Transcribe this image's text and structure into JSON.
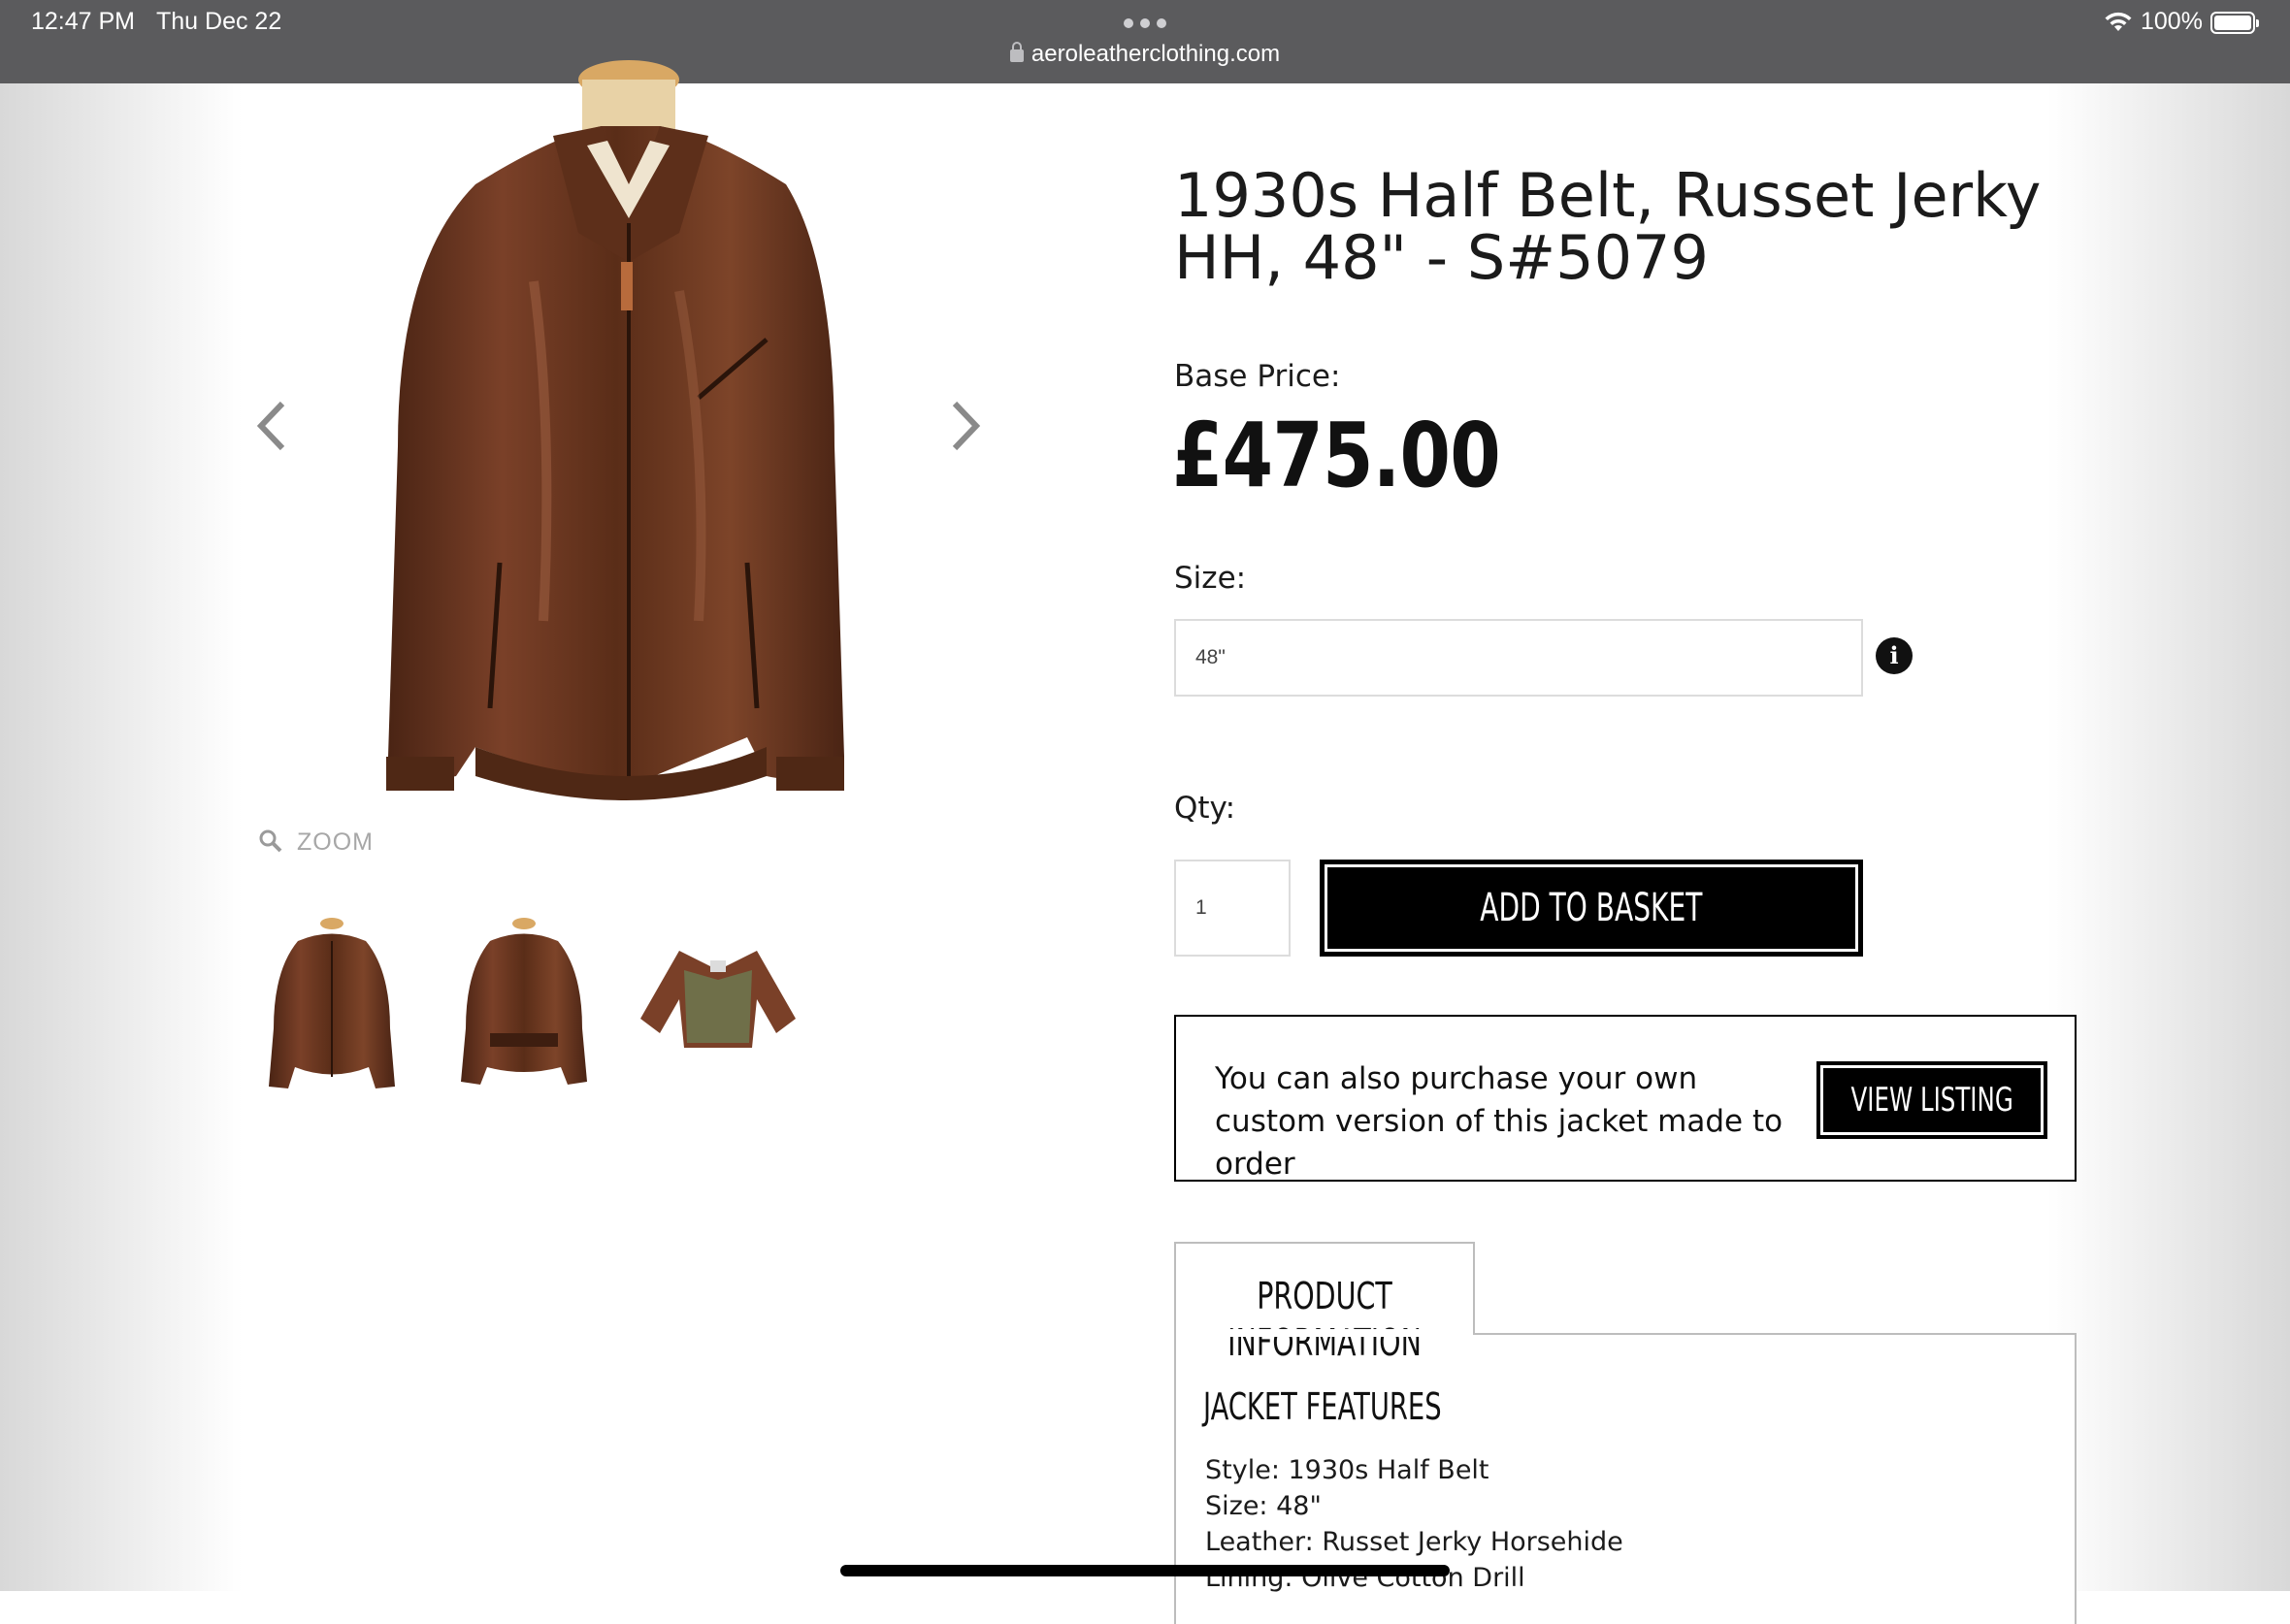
{
  "status_bar": {
    "time": "12:47 PM",
    "date": "Thu Dec 22",
    "battery": "100%",
    "url": "aeroleatherclothing.com"
  },
  "gallery": {
    "zoom_label": "ZOOM"
  },
  "product": {
    "title": "1930s Half Belt, Russet Jerky HH, 48\" - S#5079",
    "base_price_label": "Base Price:",
    "price": "£475.00",
    "size_label": "Size:",
    "size_value": "48\"",
    "qty_label": "Qty:",
    "qty_value": "1",
    "add_to_basket": "ADD TO BASKET"
  },
  "custom": {
    "text": "You can also purchase your own custom version of this jacket made to order",
    "button": "VIEW LISTING"
  },
  "tabs": {
    "product_information": "PRODUCT INFORMATION"
  },
  "features": {
    "heading": "JACKET FEATURES",
    "style": "Style: 1930s Half Belt",
    "size": "Size: 48\"",
    "leather": "Leather: Russet Jerky Horsehide",
    "lining": "Lining: Olive Cotton Drill"
  },
  "colors": {
    "leather_brown": "#6b3a22",
    "status_bar": "#5b5b5d"
  }
}
